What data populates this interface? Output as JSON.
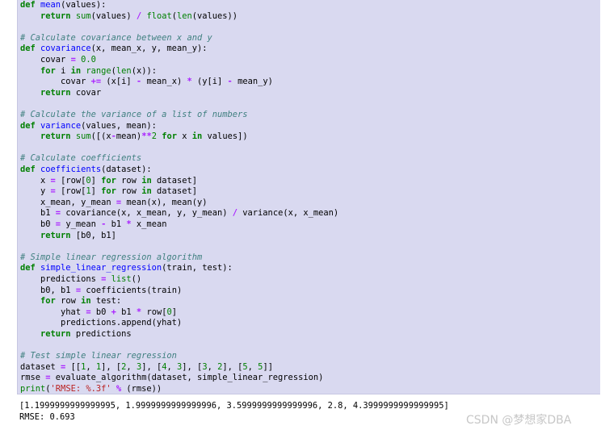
{
  "code": {
    "lines": [
      [
        [
          "kw",
          "def "
        ],
        [
          "fn",
          "mean"
        ],
        [
          "t",
          "(values):"
        ]
      ],
      [
        [
          "t",
          "    "
        ],
        [
          "kw",
          "return "
        ],
        [
          "bi",
          "sum"
        ],
        [
          "t",
          "(values) "
        ],
        [
          "op",
          "/ "
        ],
        [
          "bi",
          "float"
        ],
        [
          "t",
          "("
        ],
        [
          "bi",
          "len"
        ],
        [
          "t",
          "(values))"
        ]
      ],
      [],
      [
        [
          "cm",
          "# Calculate covariance between x and y"
        ]
      ],
      [
        [
          "kw",
          "def "
        ],
        [
          "fn",
          "covariance"
        ],
        [
          "t",
          "(x, mean_x, y, mean_y):"
        ]
      ],
      [
        [
          "t",
          "    covar "
        ],
        [
          "op",
          "= "
        ],
        [
          "nm",
          "0.0"
        ]
      ],
      [
        [
          "t",
          "    "
        ],
        [
          "kw",
          "for "
        ],
        [
          "t",
          "i "
        ],
        [
          "kw",
          "in "
        ],
        [
          "bi",
          "range"
        ],
        [
          "t",
          "("
        ],
        [
          "bi",
          "len"
        ],
        [
          "t",
          "(x)):"
        ]
      ],
      [
        [
          "t",
          "        covar "
        ],
        [
          "op",
          "+= "
        ],
        [
          "t",
          "(x[i] "
        ],
        [
          "op",
          "- "
        ],
        [
          "t",
          "mean_x) "
        ],
        [
          "op",
          "* "
        ],
        [
          "t",
          "(y[i] "
        ],
        [
          "op",
          "- "
        ],
        [
          "t",
          "mean_y)"
        ]
      ],
      [
        [
          "t",
          "    "
        ],
        [
          "kw",
          "return "
        ],
        [
          "t",
          "covar"
        ]
      ],
      [],
      [
        [
          "cm",
          "# Calculate the variance of a list of numbers"
        ]
      ],
      [
        [
          "kw",
          "def "
        ],
        [
          "fn",
          "variance"
        ],
        [
          "t",
          "(values, mean):"
        ]
      ],
      [
        [
          "t",
          "    "
        ],
        [
          "kw",
          "return "
        ],
        [
          "bi",
          "sum"
        ],
        [
          "t",
          "([(x"
        ],
        [
          "op",
          "-"
        ],
        [
          "t",
          "mean)"
        ],
        [
          "op",
          "**"
        ],
        [
          "nm",
          "2 "
        ],
        [
          "kw",
          "for "
        ],
        [
          "t",
          "x "
        ],
        [
          "kw",
          "in "
        ],
        [
          "t",
          "values])"
        ]
      ],
      [],
      [
        [
          "cm",
          "# Calculate coefficients"
        ]
      ],
      [
        [
          "kw",
          "def "
        ],
        [
          "fn",
          "coefficients"
        ],
        [
          "t",
          "(dataset):"
        ]
      ],
      [
        [
          "t",
          "    x "
        ],
        [
          "op",
          "= "
        ],
        [
          "t",
          "[row["
        ],
        [
          "nm",
          "0"
        ],
        [
          "t",
          "] "
        ],
        [
          "kw",
          "for "
        ],
        [
          "t",
          "row "
        ],
        [
          "kw",
          "in "
        ],
        [
          "t",
          "dataset]"
        ]
      ],
      [
        [
          "t",
          "    y "
        ],
        [
          "op",
          "= "
        ],
        [
          "t",
          "[row["
        ],
        [
          "nm",
          "1"
        ],
        [
          "t",
          "] "
        ],
        [
          "kw",
          "for "
        ],
        [
          "t",
          "row "
        ],
        [
          "kw",
          "in "
        ],
        [
          "t",
          "dataset]"
        ]
      ],
      [
        [
          "t",
          "    x_mean, y_mean "
        ],
        [
          "op",
          "= "
        ],
        [
          "t",
          "mean(x), mean(y)"
        ]
      ],
      [
        [
          "t",
          "    b1 "
        ],
        [
          "op",
          "= "
        ],
        [
          "t",
          "covariance(x, x_mean, y, y_mean) "
        ],
        [
          "op",
          "/ "
        ],
        [
          "t",
          "variance(x, x_mean)"
        ]
      ],
      [
        [
          "t",
          "    b0 "
        ],
        [
          "op",
          "= "
        ],
        [
          "t",
          "y_mean "
        ],
        [
          "op",
          "- "
        ],
        [
          "t",
          "b1 "
        ],
        [
          "op",
          "* "
        ],
        [
          "t",
          "x_mean"
        ]
      ],
      [
        [
          "t",
          "    "
        ],
        [
          "kw",
          "return "
        ],
        [
          "t",
          "[b0, b1]"
        ]
      ],
      [],
      [
        [
          "cm",
          "# Simple linear regression algorithm"
        ]
      ],
      [
        [
          "kw",
          "def "
        ],
        [
          "fn",
          "simple_linear_regression"
        ],
        [
          "t",
          "(train, test):"
        ]
      ],
      [
        [
          "t",
          "    predictions "
        ],
        [
          "op",
          "= "
        ],
        [
          "bi",
          "list"
        ],
        [
          "t",
          "()"
        ]
      ],
      [
        [
          "t",
          "    b0, b1 "
        ],
        [
          "op",
          "= "
        ],
        [
          "t",
          "coefficients(train)"
        ]
      ],
      [
        [
          "t",
          "    "
        ],
        [
          "kw",
          "for "
        ],
        [
          "t",
          "row "
        ],
        [
          "kw",
          "in "
        ],
        [
          "t",
          "test:"
        ]
      ],
      [
        [
          "t",
          "        yhat "
        ],
        [
          "op",
          "= "
        ],
        [
          "t",
          "b0 "
        ],
        [
          "op",
          "+ "
        ],
        [
          "t",
          "b1 "
        ],
        [
          "op",
          "* "
        ],
        [
          "t",
          "row["
        ],
        [
          "nm",
          "0"
        ],
        [
          "t",
          "]"
        ]
      ],
      [
        [
          "t",
          "        predictions.append(yhat)"
        ]
      ],
      [
        [
          "t",
          "    "
        ],
        [
          "kw",
          "return "
        ],
        [
          "t",
          "predictions"
        ]
      ],
      [],
      [
        [
          "cm",
          "# Test simple linear regression"
        ]
      ],
      [
        [
          "t",
          "dataset "
        ],
        [
          "op",
          "= "
        ],
        [
          "t",
          "[["
        ],
        [
          "nm",
          "1"
        ],
        [
          "t",
          ", "
        ],
        [
          "nm",
          "1"
        ],
        [
          "t",
          "], ["
        ],
        [
          "nm",
          "2"
        ],
        [
          "t",
          ", "
        ],
        [
          "nm",
          "3"
        ],
        [
          "t",
          "], ["
        ],
        [
          "nm",
          "4"
        ],
        [
          "t",
          ", "
        ],
        [
          "nm",
          "3"
        ],
        [
          "t",
          "], ["
        ],
        [
          "nm",
          "3"
        ],
        [
          "t",
          ", "
        ],
        [
          "nm",
          "2"
        ],
        [
          "t",
          "], ["
        ],
        [
          "nm",
          "5"
        ],
        [
          "t",
          ", "
        ],
        [
          "nm",
          "5"
        ],
        [
          "t",
          "]]"
        ]
      ],
      [
        [
          "t",
          "rmse "
        ],
        [
          "op",
          "= "
        ],
        [
          "t",
          "evaluate_algorithm(dataset, simple_linear_regression)"
        ]
      ],
      [
        [
          "bi",
          "print"
        ],
        [
          "t",
          "("
        ],
        [
          "st",
          "'RMSE: %.3f' "
        ],
        [
          "op",
          "% "
        ],
        [
          "t",
          "(rmse))"
        ]
      ]
    ]
  },
  "output": {
    "line1": "[1.1999999999999995, 1.9999999999999996, 3.5999999999999996, 2.8, 4.3999999999999995]",
    "line2": "RMSE: 0.693"
  },
  "watermark": "CSDN @梦想家DBA"
}
